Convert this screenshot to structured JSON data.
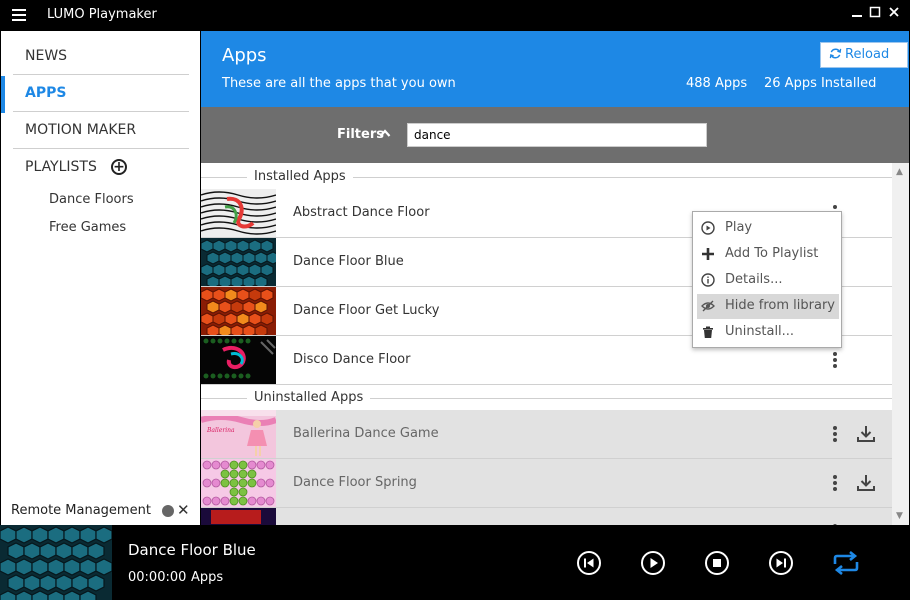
{
  "app": {
    "title": "LUMO Playmaker",
    "window_controls": [
      "minimize-icon",
      "maximize-icon",
      "close-icon"
    ]
  },
  "sidebar": {
    "nav": [
      {
        "label": "NEWS",
        "active": false
      },
      {
        "label": "APPS",
        "active": true
      },
      {
        "label": "MOTION MAKER",
        "active": false
      }
    ],
    "playlists_label": "PLAYLISTS",
    "playlists": [
      "Dance Floors",
      "Free Games"
    ],
    "remote_label": "Remote Management"
  },
  "header": {
    "title": "Apps",
    "subtitle": "These are all the apps that you own",
    "apps_count": "488 Apps",
    "installed_count": "26 Apps Installed",
    "reload_label": "Reload"
  },
  "filters": {
    "label": "Filters",
    "query": "dance"
  },
  "sections": {
    "installed": "Installed Apps",
    "uninstalled": "Uninstalled Apps"
  },
  "installed_apps": [
    {
      "name": "Abstract Dance Floor",
      "thumb": "abstract"
    },
    {
      "name": "Dance Floor Blue",
      "thumb": "blue"
    },
    {
      "name": "Dance Floor Get Lucky",
      "thumb": "orange"
    },
    {
      "name": "Disco Dance Floor",
      "thumb": "disco"
    }
  ],
  "uninstalled_apps": [
    {
      "name": "Ballerina Dance Game",
      "thumb": "ballerina"
    },
    {
      "name": "Dance Floor Spring",
      "thumb": "spring"
    }
  ],
  "context_menu": [
    {
      "label": "Play",
      "icon": "play-circle-icon",
      "highlighted": false
    },
    {
      "label": "Add To Playlist",
      "icon": "plus-icon",
      "highlighted": false
    },
    {
      "label": "Details...",
      "icon": "info-icon",
      "highlighted": false
    },
    {
      "label": "Hide from library",
      "icon": "eye-slash-icon",
      "highlighted": true
    },
    {
      "label": "Uninstall...",
      "icon": "trash-icon",
      "highlighted": false
    }
  ],
  "player": {
    "title": "Dance Floor Blue",
    "time": "00:00:00",
    "category": "Apps",
    "controls": [
      "previous-icon",
      "play-icon",
      "stop-icon",
      "next-icon",
      "repeat-icon"
    ]
  },
  "colors": {
    "accent": "#1e88e5",
    "filter_bar": "#6e6e6e",
    "uninstalled_row": "#e2e2e2"
  }
}
